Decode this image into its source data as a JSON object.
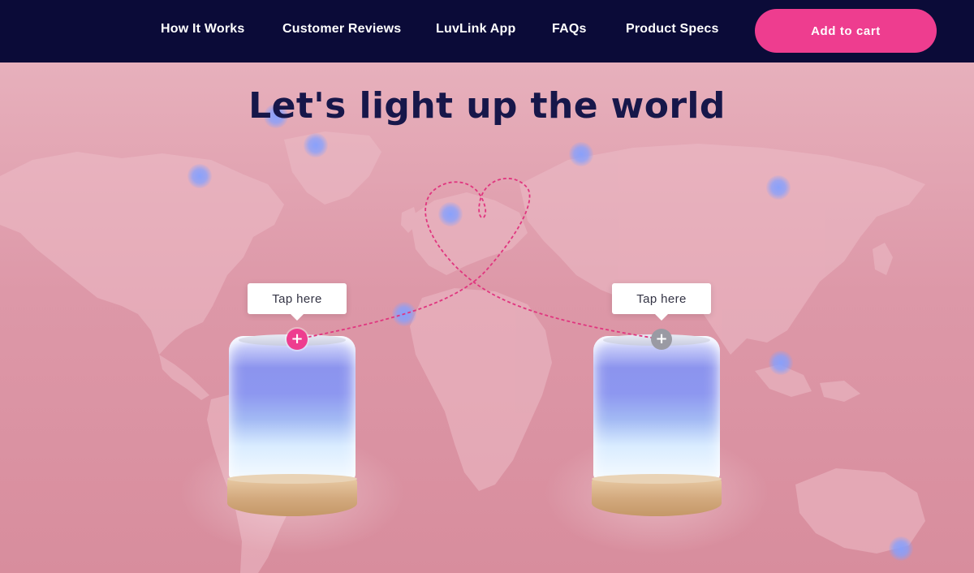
{
  "nav": {
    "links": [
      {
        "label": "How It Works"
      },
      {
        "label": "Customer Reviews"
      },
      {
        "label": "LuvLink App"
      },
      {
        "label": "FAQs"
      },
      {
        "label": "Product Specs"
      }
    ],
    "cart_button": "Add to cart"
  },
  "hero": {
    "headline": "Let's light up the world",
    "lamps": [
      {
        "tooltip": "Tap here",
        "marker": "+",
        "state": "active"
      },
      {
        "tooltip": "Tap here",
        "marker": "+",
        "state": "inactive"
      }
    ]
  },
  "colors": {
    "nav_background": "#0b0b38",
    "accent_pink": "#ee3d8f",
    "hero_background": "#dd98a8",
    "headline_color": "#17174a",
    "glow_blue": "#84a0ff"
  },
  "icons": [
    "plus-icon",
    "world-map-graphic",
    "heart-path-graphic"
  ]
}
